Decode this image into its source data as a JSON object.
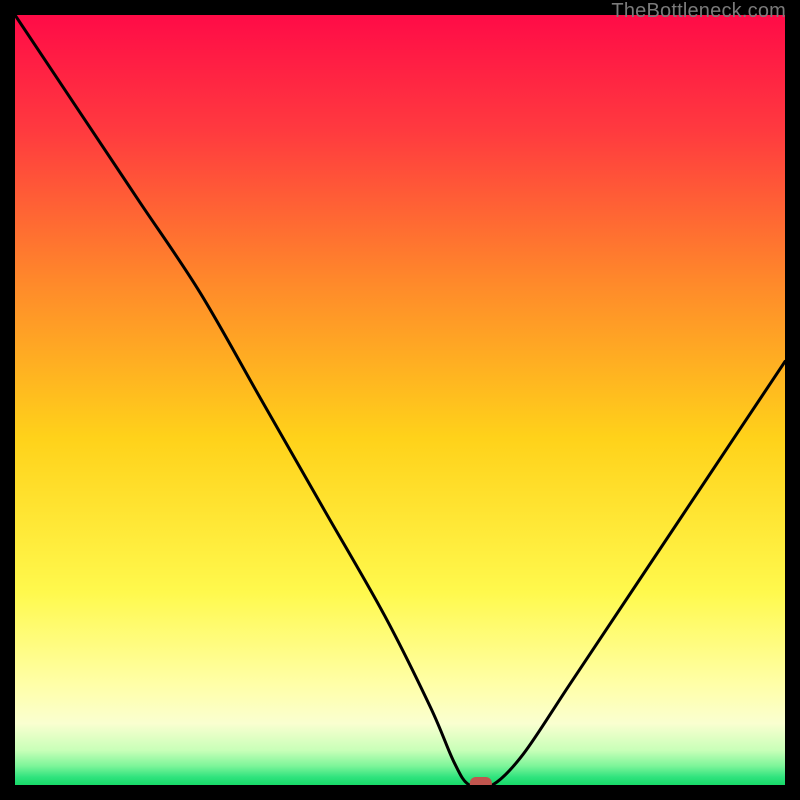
{
  "watermark": "TheBottleneck.com",
  "chart_data": {
    "type": "line",
    "title": "",
    "xlabel": "",
    "ylabel": "",
    "xlim": [
      0,
      100
    ],
    "ylim": [
      0,
      100
    ],
    "series": [
      {
        "name": "bottleneck-curve",
        "x": [
          0,
          8,
          16,
          24,
          32,
          40,
          48,
          54,
          57,
          59,
          62,
          66,
          72,
          80,
          90,
          100
        ],
        "y": [
          100,
          88,
          76,
          64,
          50,
          36,
          22,
          10,
          3,
          0,
          0,
          4,
          13,
          25,
          40,
          55
        ]
      }
    ],
    "marker": {
      "x": 60.5,
      "y": 0,
      "color": "#c1554e"
    },
    "gradient_stops": [
      {
        "offset": 0.0,
        "color": "#ff0b47"
      },
      {
        "offset": 0.15,
        "color": "#ff3a3f"
      },
      {
        "offset": 0.35,
        "color": "#ff8a2a"
      },
      {
        "offset": 0.55,
        "color": "#ffd21a"
      },
      {
        "offset": 0.75,
        "color": "#fff94d"
      },
      {
        "offset": 0.87,
        "color": "#ffffa8"
      },
      {
        "offset": 0.92,
        "color": "#faffd0"
      },
      {
        "offset": 0.955,
        "color": "#c8ffb8"
      },
      {
        "offset": 0.975,
        "color": "#7ef59a"
      },
      {
        "offset": 0.99,
        "color": "#2fe37d"
      },
      {
        "offset": 1.0,
        "color": "#17d968"
      }
    ]
  }
}
